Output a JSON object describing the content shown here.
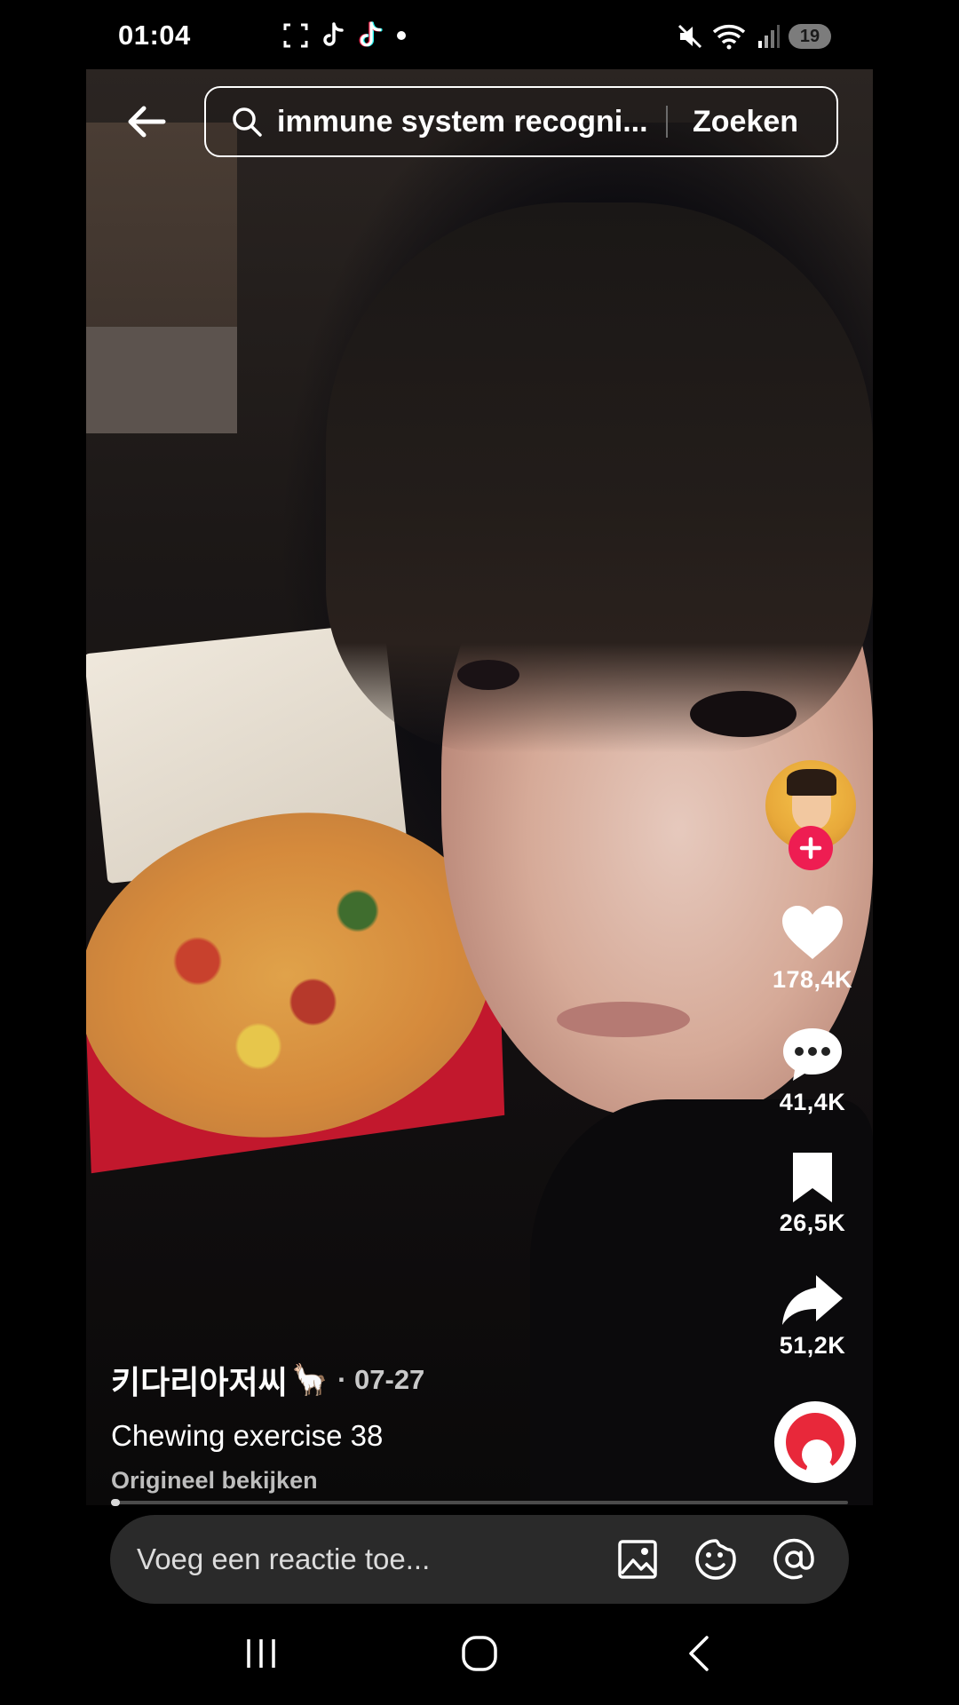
{
  "status_bar": {
    "time": "01:04",
    "battery": "19",
    "left_icons": [
      "screenshot-icon",
      "tiktok-icon",
      "tiktok-icon",
      "dot-icon"
    ],
    "right_icons": [
      "mute-icon",
      "wifi-icon",
      "signal-icon",
      "battery-icon"
    ]
  },
  "search": {
    "query": "immune system recogni...",
    "button_label": "Zoeken"
  },
  "actions": {
    "likes": "178,4K",
    "comments": "41,4K",
    "saves": "26,5K",
    "shares": "51,2K"
  },
  "post": {
    "author": "키다리아저씨",
    "author_emoji": "🦙",
    "date": "· 07-27",
    "caption": "Chewing exercise 38",
    "view_original": "Origineel bekijken",
    "progress": 0.01
  },
  "comment_bar": {
    "placeholder": "Voeg een reactie toe..."
  },
  "colors": {
    "accent": "#ee1d52",
    "comment_bar_bg": "#2a2a2a"
  }
}
